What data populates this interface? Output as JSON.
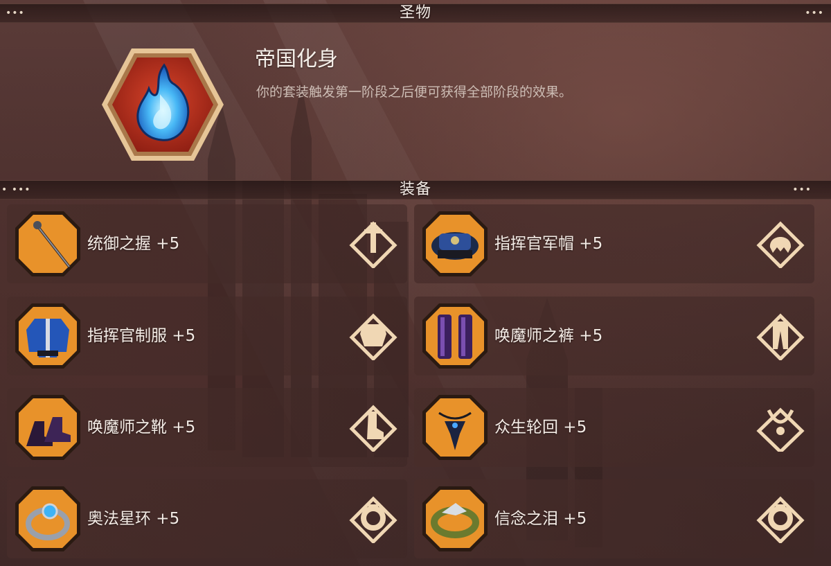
{
  "relic_section": {
    "title": "圣物",
    "relic": {
      "name": "帝国化身",
      "description": "你的套装触发第一阶段之后便可获得全部阶段的效果。",
      "icon": "blue-flame-icon"
    }
  },
  "equipment_section": {
    "title": "装备",
    "items": [
      {
        "name": "统御之握 +5",
        "icon": "staff-icon",
        "slot_icon": "weapon-slot-icon"
      },
      {
        "name": "指挥官军帽 +5",
        "icon": "hat-icon",
        "slot_icon": "helmet-slot-icon"
      },
      {
        "name": "指挥官制服 +5",
        "icon": "uniform-icon",
        "slot_icon": "chest-slot-icon"
      },
      {
        "name": "唤魔师之裤 +5",
        "icon": "pants-icon",
        "slot_icon": "legs-slot-icon"
      },
      {
        "name": "唤魔师之靴 +5",
        "icon": "boots-icon",
        "slot_icon": "boots-slot-icon"
      },
      {
        "name": "众生轮回 +5",
        "icon": "amulet-icon",
        "slot_icon": "necklace-slot-icon"
      },
      {
        "name": "奥法星环 +5",
        "icon": "ring-icon",
        "slot_icon": "ring-slot-icon"
      },
      {
        "name": "信念之泪 +5",
        "icon": "ring-icon",
        "slot_icon": "ring-slot-icon"
      }
    ]
  },
  "colors": {
    "accent_gold": "#e0b67a",
    "icon_orange": "#e8922a",
    "relic_red": "#c0341f",
    "flame_blue": "#3fb3f5"
  }
}
